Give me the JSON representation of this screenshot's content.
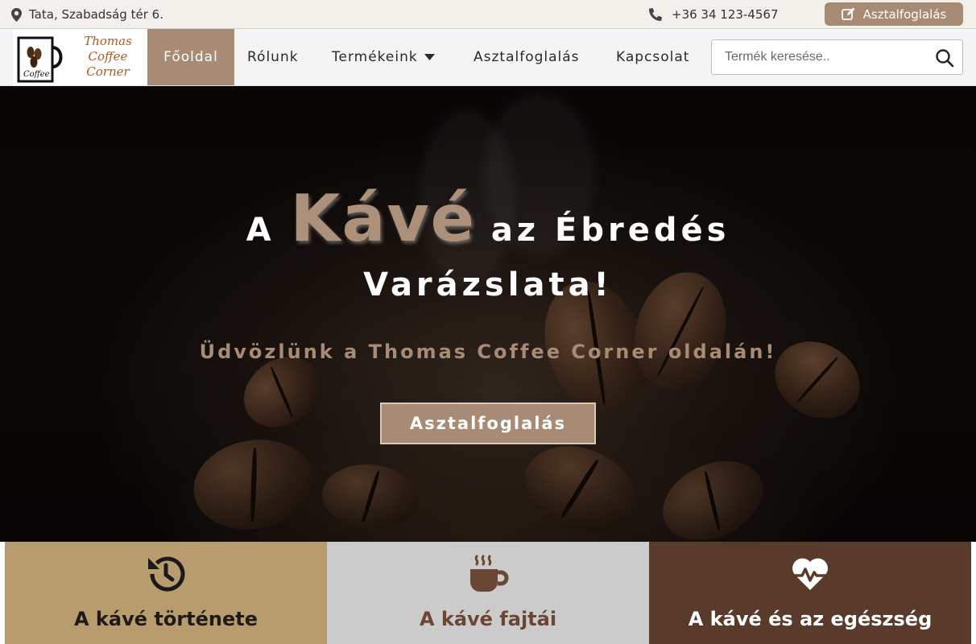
{
  "topbar": {
    "address": "Tata, Szabadság tér 6.",
    "address_icon": "map-pin-icon",
    "phone": "+36 34 123-4567",
    "phone_icon": "phone-icon",
    "reserve_label": "Asztalfoglalás",
    "reserve_icon": "edit-icon"
  },
  "logo": {
    "brand_line1": "Thomas Coffee",
    "brand_line2": "Corner",
    "mug_text": "Coffee"
  },
  "nav": {
    "items": [
      {
        "label": "Főoldal",
        "active": true
      },
      {
        "label": "Rólunk",
        "active": false
      },
      {
        "label": "Termékeink",
        "active": false,
        "has_dropdown": true
      },
      {
        "label": "Asztalfoglalás",
        "active": false
      },
      {
        "label": "Kapcsolat",
        "active": false
      }
    ]
  },
  "search": {
    "placeholder": "Termék keresése..",
    "value": ""
  },
  "hero": {
    "title_pre": "A",
    "title_accent": "Kávé",
    "title_post": "az Ébredés",
    "title_line2": "Varázslata!",
    "subtitle": "Üdvözlünk a Thomas Coffee Corner oldalán!",
    "button_label": "Asztalfoglalás"
  },
  "cards": [
    {
      "title": "A kávé története",
      "icon": "history-icon"
    },
    {
      "title": "A kávé fajtái",
      "icon": "coffee-cup-icon"
    },
    {
      "title": "A kávé és az egészség",
      "icon": "heartbeat-icon"
    }
  ],
  "colors": {
    "accent": "#a88b74",
    "card1_bg": "#b99c6e",
    "card2_bg": "#cbcbcb",
    "card3_bg": "#5a3a2a"
  }
}
